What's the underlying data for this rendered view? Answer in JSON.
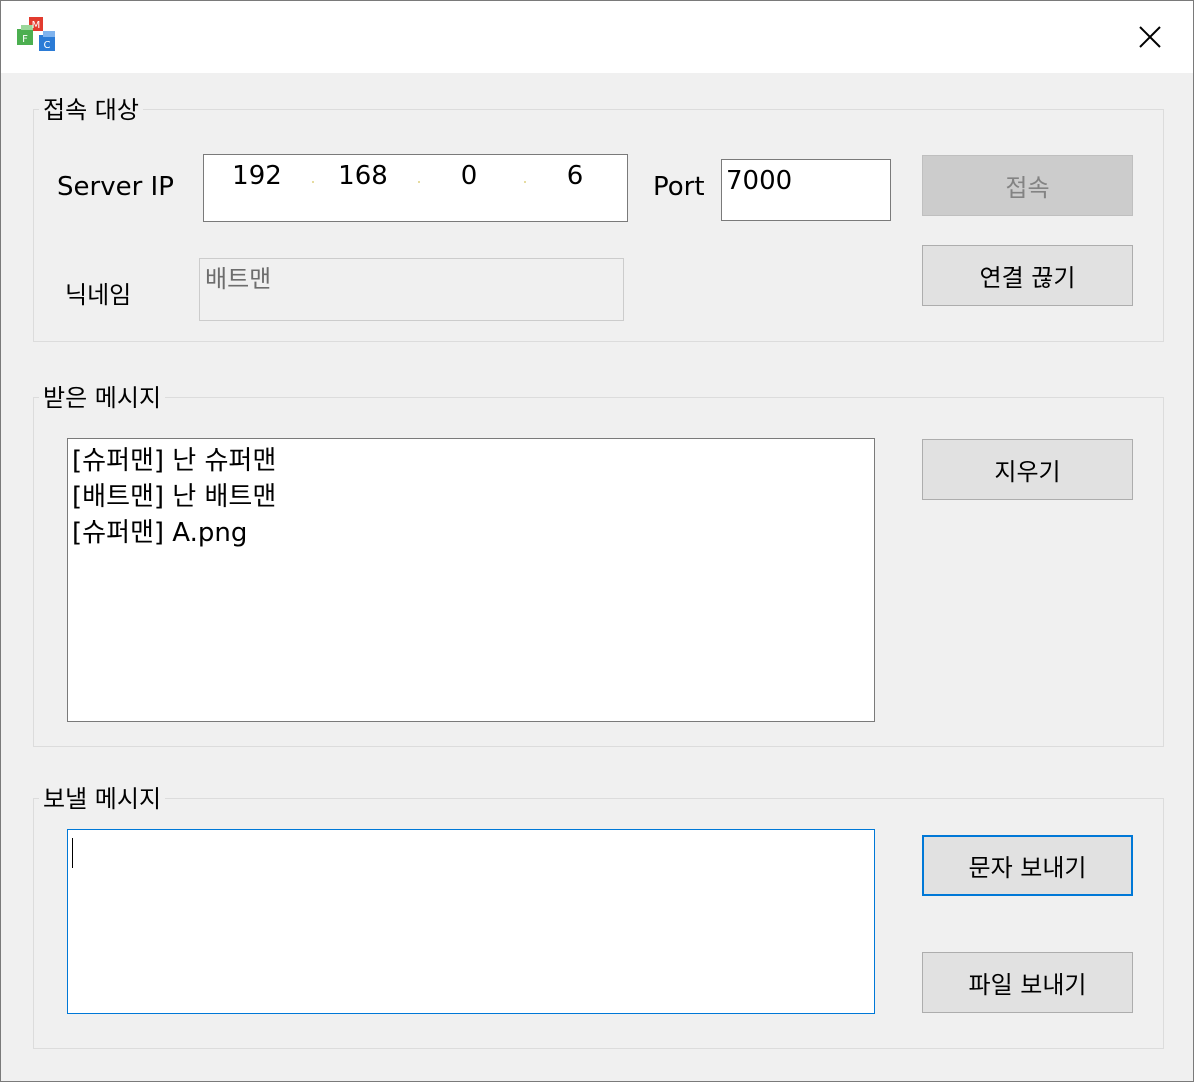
{
  "window": {
    "close_glyph": "✕"
  },
  "connection": {
    "group_title": "접속 대상",
    "server_ip_label": "Server IP",
    "ip_octets": [
      "192",
      "168",
      "0",
      "6"
    ],
    "port_label": "Port",
    "port_value": "7000",
    "connect_button": "접속",
    "nickname_label": "닉네임",
    "nickname_value": "배트맨",
    "disconnect_button": "연결 끊기"
  },
  "received": {
    "group_title": "받은 메시지",
    "messages": [
      "[슈퍼맨] 난 슈퍼맨",
      "[배트맨] 난 배트맨",
      "[슈퍼맨] A.png"
    ],
    "clear_button": "지우기"
  },
  "send": {
    "group_title": "보낼 메시지",
    "input_value": "",
    "send_text_button": "문자 보내기",
    "send_file_button": "파일 보내기"
  },
  "colors": {
    "focus_accent": "#0078d7",
    "disabled_text": "#838383"
  }
}
